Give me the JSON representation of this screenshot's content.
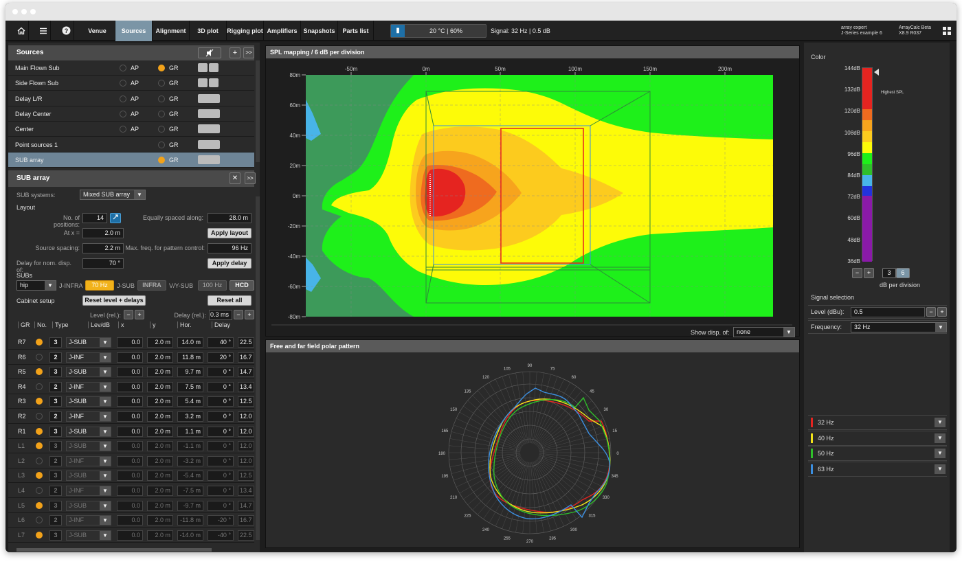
{
  "toolbar": {
    "home_icon": "home-icon",
    "menu_icon": "menu-icon",
    "help_icon": "help-icon",
    "tabs": [
      "Venue",
      "Sources",
      "Alignment",
      "3D plot",
      "Rigging plot",
      "Amplifiers",
      "Snapshots",
      "Parts list"
    ],
    "active_tab": "Sources",
    "temperature": "20 °C | 60%",
    "signal": "Signal: 32 Hz | 0.5 dB",
    "project_line1": "array expert",
    "project_line2": "J-Series example 6",
    "app_name": "ArrayCalc Beta",
    "version": "X8.9 R037"
  },
  "sources": {
    "title": "Sources",
    "add_label": "+",
    "expand_label": ">>",
    "rows": [
      {
        "name": "Main Flown Sub",
        "ap": "AP",
        "gr": "GR",
        "gr_on": true
      },
      {
        "name": "Side Flown Sub",
        "ap": "AP",
        "gr": "GR",
        "gr_on": false
      },
      {
        "name": "Delay L/R",
        "ap": "AP",
        "gr": "GR",
        "gr_on": false
      },
      {
        "name": "Delay Center",
        "ap": "AP",
        "gr": "GR",
        "gr_on": false
      },
      {
        "name": "Center",
        "ap": "AP",
        "gr": "GR",
        "gr_on": false
      },
      {
        "name": "Point sources 1",
        "ap": "",
        "gr": "GR",
        "gr_on": false
      },
      {
        "name": "SUB array",
        "ap": "",
        "gr": "GR",
        "gr_on": true
      }
    ]
  },
  "sub_array": {
    "title": "SUB array",
    "systems_label": "SUB systems:",
    "systems_value": "Mixed SUB array",
    "layout_label": "Layout",
    "num_positions_label": "No. of positions:",
    "num_positions": "14",
    "equally_label": "Equally spaced along:",
    "equally_value": "28.0 m",
    "at_x_label": "At x =",
    "at_x_value": "2.0 m",
    "apply_layout": "Apply layout",
    "source_spacing_label": "Source spacing:",
    "source_spacing": "2.2 m",
    "max_freq_label": "Max. freq. for pattern control:",
    "max_freq": "96 Hz",
    "delay_nom_label": "Delay for nom. disp. of:",
    "delay_nom": "70 °",
    "apply_delay": "Apply delay",
    "subs_label": "SUBs",
    "subs_mode": "hip",
    "jinfra_label": "J-INFRA",
    "jinfra_value": "70 Hz",
    "jsub_label": "J-SUB",
    "jsub_value": "INFRA",
    "vysub_label": "V/Y-SUB",
    "vysub_value": "100 Hz",
    "hcd": "HCD",
    "cabinet_label": "Cabinet setup",
    "reset_level": "Reset level + delays",
    "reset_all": "Reset all",
    "level_rel_label": "Level (rel.):",
    "delay_rel_label": "Delay (rel.):",
    "delay_rel": "0.3 ms",
    "headers": [
      "GR",
      "No.",
      "Type",
      "Lev/dB",
      "x",
      "y",
      "Hor.",
      "Delay"
    ],
    "rows": [
      {
        "name": "R7",
        "gr": true,
        "no": "3",
        "type": "J-SUB",
        "lev": "0.0",
        "x": "2.0 m",
        "y": "14.0 m",
        "hor": "40 °",
        "delay": "22.5",
        "dim": false
      },
      {
        "name": "R6",
        "gr": false,
        "no": "2",
        "type": "J-INF",
        "lev": "0.0",
        "x": "2.0 m",
        "y": "11.8 m",
        "hor": "20 °",
        "delay": "16.7",
        "dim": false
      },
      {
        "name": "R5",
        "gr": true,
        "no": "3",
        "type": "J-SUB",
        "lev": "0.0",
        "x": "2.0 m",
        "y": "9.7 m",
        "hor": "0 °",
        "delay": "14.7",
        "dim": false
      },
      {
        "name": "R4",
        "gr": false,
        "no": "2",
        "type": "J-INF",
        "lev": "0.0",
        "x": "2.0 m",
        "y": "7.5 m",
        "hor": "0 °",
        "delay": "13.4",
        "dim": false
      },
      {
        "name": "R3",
        "gr": true,
        "no": "3",
        "type": "J-SUB",
        "lev": "0.0",
        "x": "2.0 m",
        "y": "5.4 m",
        "hor": "0 °",
        "delay": "12.5",
        "dim": false
      },
      {
        "name": "R2",
        "gr": false,
        "no": "2",
        "type": "J-INF",
        "lev": "0.0",
        "x": "2.0 m",
        "y": "3.2 m",
        "hor": "0 °",
        "delay": "12.0",
        "dim": false
      },
      {
        "name": "R1",
        "gr": true,
        "no": "3",
        "type": "J-SUB",
        "lev": "0.0",
        "x": "2.0 m",
        "y": "1.1 m",
        "hor": "0 °",
        "delay": "12.0",
        "dim": false
      },
      {
        "name": "L1",
        "gr": true,
        "no": "3",
        "type": "J-SUB",
        "lev": "0.0",
        "x": "2.0 m",
        "y": "-1.1 m",
        "hor": "0 °",
        "delay": "12.0",
        "dim": true
      },
      {
        "name": "L2",
        "gr": false,
        "no": "2",
        "type": "J-INF",
        "lev": "0.0",
        "x": "2.0 m",
        "y": "-3.2 m",
        "hor": "0 °",
        "delay": "12.0",
        "dim": true
      },
      {
        "name": "L3",
        "gr": true,
        "no": "3",
        "type": "J-SUB",
        "lev": "0.0",
        "x": "2.0 m",
        "y": "-5.4 m",
        "hor": "0 °",
        "delay": "12.5",
        "dim": true
      },
      {
        "name": "L4",
        "gr": false,
        "no": "2",
        "type": "J-INF",
        "lev": "0.0",
        "x": "2.0 m",
        "y": "-7.5 m",
        "hor": "0 °",
        "delay": "13.4",
        "dim": true
      },
      {
        "name": "L5",
        "gr": true,
        "no": "3",
        "type": "J-SUB",
        "lev": "0.0",
        "x": "2.0 m",
        "y": "-9.7 m",
        "hor": "0 °",
        "delay": "14.7",
        "dim": true
      },
      {
        "name": "L6",
        "gr": false,
        "no": "2",
        "type": "J-INF",
        "lev": "0.0",
        "x": "2.0 m",
        "y": "-11.8 m",
        "hor": "-20 °",
        "delay": "16.7",
        "dim": true
      },
      {
        "name": "L7",
        "gr": true,
        "no": "3",
        "type": "J-SUB",
        "lev": "0.0",
        "x": "2.0 m",
        "y": "-14.0 m",
        "hor": "-40 °",
        "delay": "22.5",
        "dim": true
      }
    ]
  },
  "spl": {
    "title": "SPL mapping / 6 dB per division",
    "x_ticks": [
      "-50m",
      "0m",
      "50m",
      "100m",
      "150m",
      "200m"
    ],
    "y_ticks": [
      "80m",
      "60m",
      "40m",
      "20m",
      "0m",
      "-20m",
      "-40m",
      "-60m",
      "-80m"
    ],
    "show_disp_label": "Show disp. of:",
    "show_disp_value": "none"
  },
  "polar": {
    "title": "Free and far field polar pattern",
    "angle_labels": [
      "0",
      "15",
      "30",
      "45",
      "60",
      "75",
      "90",
      "105",
      "120",
      "135",
      "150",
      "165",
      "180",
      "195",
      "210",
      "225",
      "240",
      "255",
      "270",
      "285",
      "300",
      "315",
      "330",
      "345"
    ]
  },
  "color": {
    "title": "Color",
    "scale_labels": [
      "144dB",
      "132dB",
      "120dB",
      "108dB",
      "96dB",
      "84dB",
      "72dB",
      "60dB",
      "48dB",
      "36dB"
    ],
    "highest_label": "Highest SPL",
    "minus": "−",
    "plus": "+",
    "div_options": [
      "3",
      "6"
    ],
    "div_label": "dB per division"
  },
  "signal_selection": {
    "title": "Signal selection",
    "level_label": "Level (dBu):",
    "level_value": "0.5",
    "freq_label": "Frequency:",
    "freq_value": "32 Hz"
  },
  "frequencies": [
    {
      "label": "32 Hz",
      "color": "#e52420"
    },
    {
      "label": "40 Hz",
      "color": "#f1e21a"
    },
    {
      "label": "50 Hz",
      "color": "#2fbf2a"
    },
    {
      "label": "63 Hz",
      "color": "#3c8fe0"
    }
  ]
}
